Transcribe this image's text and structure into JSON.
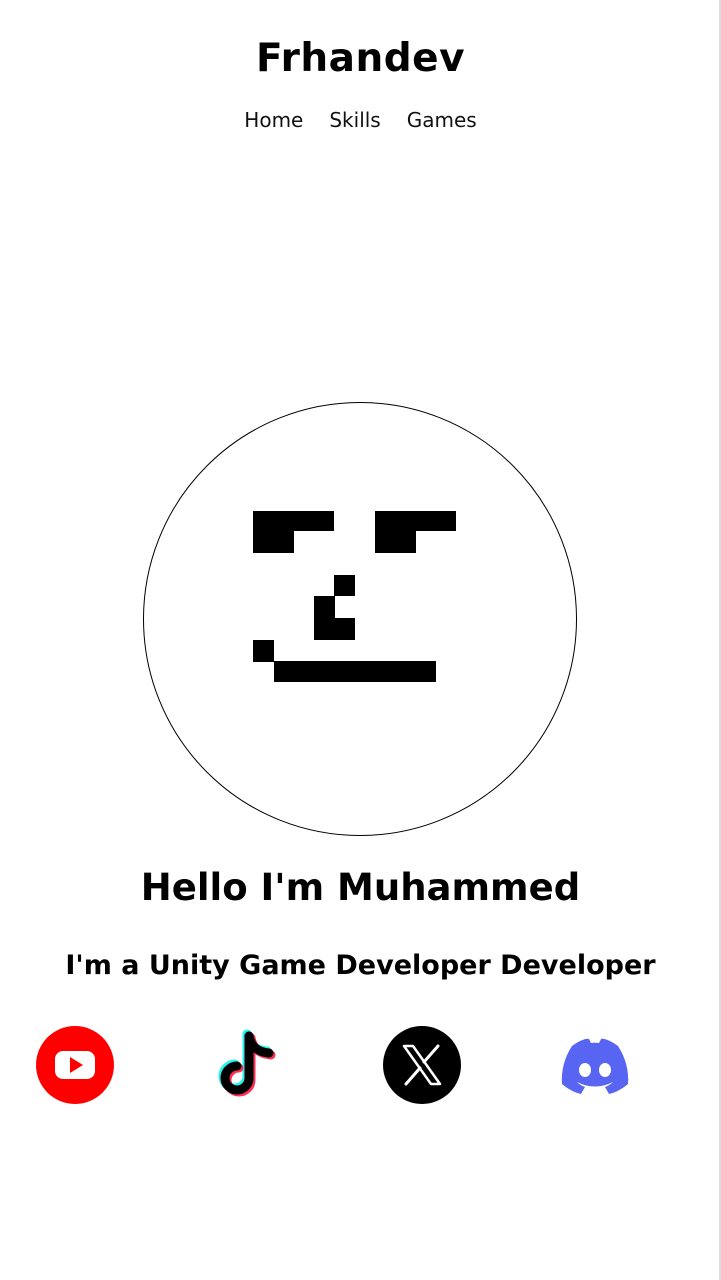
{
  "header": {
    "brand": "Frhandev",
    "nav": [
      {
        "label": "Home"
      },
      {
        "label": "Skills"
      },
      {
        "label": "Games"
      }
    ]
  },
  "hero": {
    "avatar_icon": "pixel-smirk-face-icon",
    "greeting": "Hello I'm Muhammed",
    "role": "I'm a Unity Game Developer Developer"
  },
  "social": [
    {
      "icon": "youtube-icon",
      "color": "#FF0000"
    },
    {
      "icon": "tiktok-icon",
      "color": "#000000",
      "accents": [
        "#25F4EE",
        "#FE2C55"
      ]
    },
    {
      "icon": "x-icon",
      "color": "#000000"
    },
    {
      "icon": "discord-icon",
      "color": "#5865F2"
    }
  ]
}
